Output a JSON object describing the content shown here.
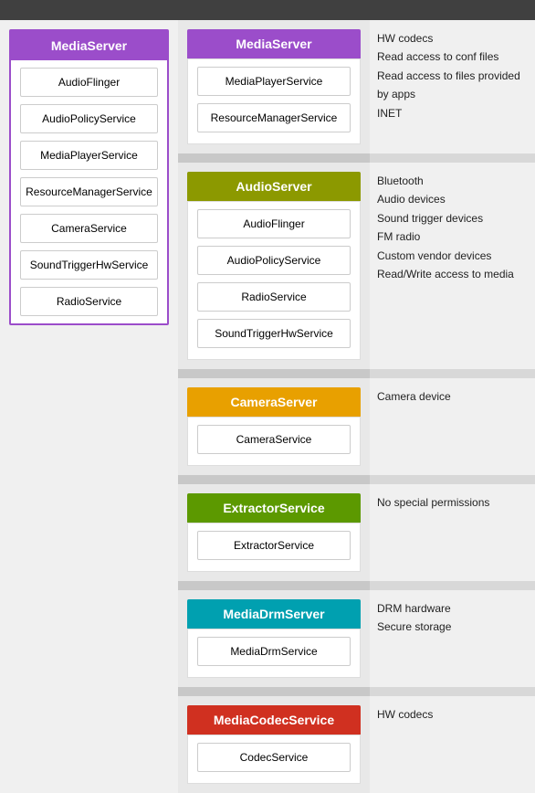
{
  "header": {
    "bg": "#404040"
  },
  "left_column": {
    "header": "MediaServer",
    "services": [
      "AudioFlinger",
      "AudioPolicyService",
      "MediaPlayerService",
      "ResourceManagerService",
      "CameraService",
      "SoundTriggerHwService",
      "RadioService"
    ]
  },
  "sections": [
    {
      "id": "mediaserver",
      "header": "MediaServer",
      "header_color": "purple",
      "services": [
        "MediaPlayerService",
        "ResourceManagerService"
      ],
      "permissions": [
        "HW codecs",
        "Read access to conf files",
        "Read access to files provided by apps",
        "INET"
      ]
    },
    {
      "id": "audioserver",
      "header": "AudioServer",
      "header_color": "olive",
      "services": [
        "AudioFlinger",
        "AudioPolicyService",
        "RadioService",
        "SoundTriggerHwService"
      ],
      "permissions": [
        "Bluetooth",
        "Audio devices",
        "Sound trigger devices",
        "FM radio",
        "Custom vendor devices",
        "Read/Write access to media"
      ]
    },
    {
      "id": "cameraserver",
      "header": "CameraServer",
      "header_color": "orange",
      "services": [
        "CameraService"
      ],
      "permissions": [
        "Camera device"
      ]
    },
    {
      "id": "extractorservice",
      "header": "ExtractorService",
      "header_color": "green-dark",
      "services": [
        "ExtractorService"
      ],
      "permissions": [
        "No special permissions"
      ]
    },
    {
      "id": "mediadrmserver",
      "header": "MediaDrmServer",
      "header_color": "teal",
      "services": [
        "MediaDrmService"
      ],
      "permissions": [
        "DRM hardware",
        "Secure storage"
      ]
    },
    {
      "id": "mediacodecservice",
      "header": "MediaCodecService",
      "header_color": "red",
      "services": [
        "CodecService"
      ],
      "permissions": [
        "HW codecs"
      ]
    }
  ]
}
